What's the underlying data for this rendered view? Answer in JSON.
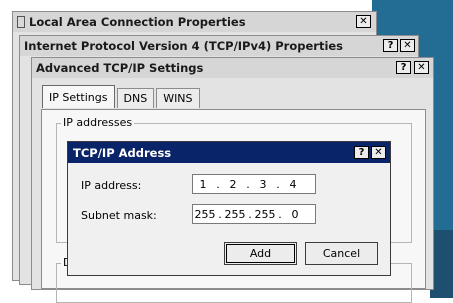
{
  "windows": {
    "local_area": {
      "title": "Local Area Connection Properties",
      "close": "✕"
    },
    "ipv4": {
      "title": "Internet Protocol Version 4 (TCP/IPv4) Properties",
      "help": "?",
      "close": "✕"
    },
    "advanced": {
      "title": "Advanced TCP/IP Settings",
      "help": "?",
      "close": "✕",
      "tabs": [
        "IP Settings",
        "DNS",
        "WINS"
      ],
      "group_label": "IP addresses",
      "bottom_group_fragment": "D"
    },
    "tcpip_address": {
      "title": "TCP/IP Address",
      "help": "?",
      "close": "✕",
      "ip_label": "IP address:",
      "ip_octets": [
        "1",
        "2",
        "3",
        "4"
      ],
      "mask_label": "Subnet mask:",
      "mask_octets": [
        "255",
        "255",
        "255",
        "0"
      ],
      "octet_separator": ".",
      "add_label": "Add",
      "cancel_label": "Cancel"
    }
  },
  "colors": {
    "active_title": "#0a246a",
    "desktop_blue": "#236d94"
  },
  "icons": {
    "local_area_title_icon": "network-adapter-icon"
  }
}
